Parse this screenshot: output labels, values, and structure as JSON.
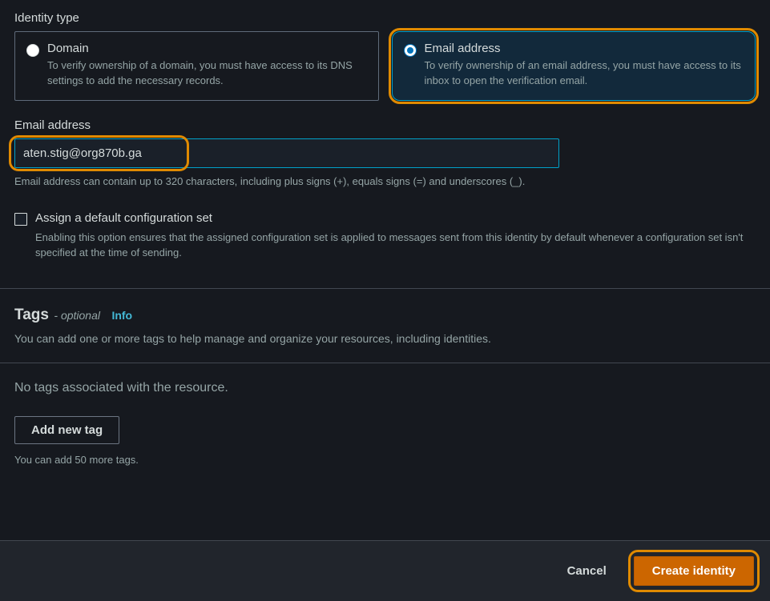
{
  "identityType": {
    "label": "Identity type",
    "options": [
      {
        "title": "Domain",
        "desc": "To verify ownership of a domain, you must have access to its DNS settings to add the necessary records."
      },
      {
        "title": "Email address",
        "desc": "To verify ownership of an email address, you must have access to its inbox to open the verification email."
      }
    ]
  },
  "emailField": {
    "label": "Email address",
    "value": "aten.stig@org870b.ga",
    "helper": "Email address can contain up to 320 characters, including plus signs (+), equals signs (=) and underscores (_)."
  },
  "configSet": {
    "title": "Assign a default configuration set",
    "desc": "Enabling this option ensures that the assigned configuration set is applied to messages sent from this identity by default whenever a configuration set isn't specified at the time of sending."
  },
  "tags": {
    "heading": "Tags",
    "optional": "- optional",
    "info": "Info",
    "sub": "You can add one or more tags to help manage and organize your resources, including identities.",
    "noTags": "No tags associated with the resource.",
    "addBtn": "Add new tag",
    "limit": "You can add 50 more tags."
  },
  "footer": {
    "cancel": "Cancel",
    "create": "Create identity"
  }
}
